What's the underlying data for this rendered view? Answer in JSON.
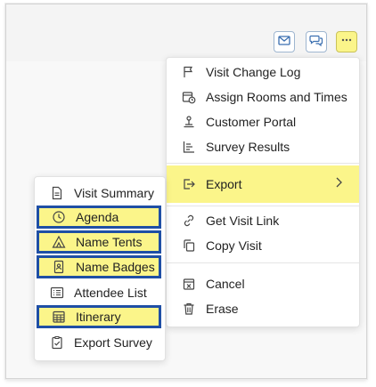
{
  "toolbar": {
    "email_icon": "envelope-icon",
    "chat_icon": "chat-bubbles-icon",
    "more_icon": "ellipsis-icon"
  },
  "main_menu": {
    "items": [
      {
        "label": "Visit Change Log",
        "icon": "flag-icon"
      },
      {
        "label": "Assign Rooms and Times",
        "icon": "calendar-clock-icon"
      },
      {
        "label": "Customer Portal",
        "icon": "portal-icon"
      },
      {
        "label": "Survey Results",
        "icon": "bar-list-icon"
      },
      {
        "label": "Export",
        "icon": "export-icon",
        "highlighted": true
      },
      {
        "label": "Get Visit Link",
        "icon": "link-icon"
      },
      {
        "label": "Copy Visit",
        "icon": "copy-icon"
      },
      {
        "label": "Cancel",
        "icon": "cancel-calendar-icon"
      },
      {
        "label": "Erase",
        "icon": "trash-icon"
      }
    ]
  },
  "export_submenu": {
    "items": [
      {
        "label": "Visit Summary",
        "icon": "document-icon",
        "highlighted": false
      },
      {
        "label": "Agenda",
        "icon": "clock-icon",
        "highlighted": true
      },
      {
        "label": "Name Tents",
        "icon": "tent-icon",
        "highlighted": true
      },
      {
        "label": "Name Badges",
        "icon": "badge-icon",
        "highlighted": true
      },
      {
        "label": "Attendee List",
        "icon": "list-icon",
        "highlighted": false
      },
      {
        "label": "Itinerary",
        "icon": "grid-calendar-icon",
        "highlighted": true
      },
      {
        "label": "Export Survey",
        "icon": "clipboard-check-icon",
        "highlighted": false
      }
    ]
  },
  "colors": {
    "highlight": "#fbf58a",
    "outline": "#1f4fa5"
  }
}
